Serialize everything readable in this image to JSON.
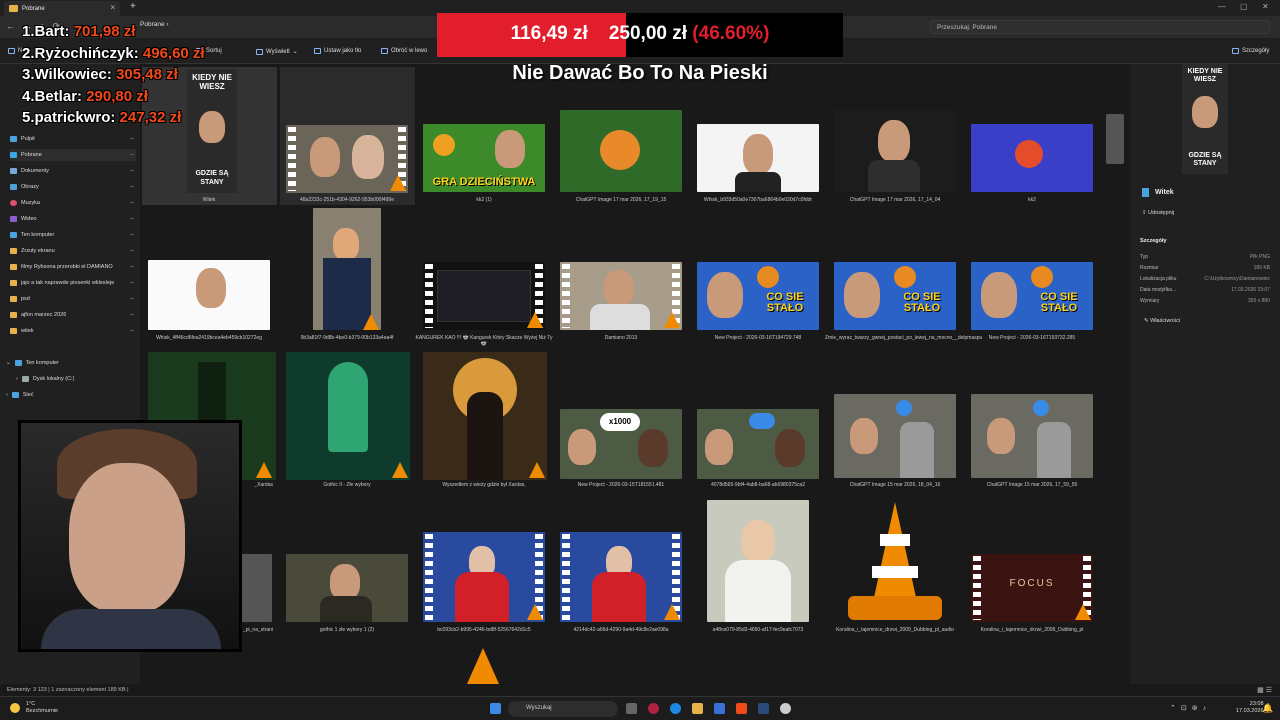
{
  "window": {
    "tab_title": "Pobrane",
    "breadcrumb": "Pobrane",
    "search_placeholder": "Przeszukaj: Pobrane"
  },
  "commands": {
    "view": "Wyświetl",
    "sort": "Sortuj",
    "set_background": "Ustaw jako tło",
    "rotate_left": "Obróć w lewo",
    "details": "Szczegóły",
    "new": "No"
  },
  "sidebar": {
    "items": [
      {
        "label": "Pulpit"
      },
      {
        "label": "Pobrane"
      },
      {
        "label": "Dokumenty"
      },
      {
        "label": "Obrazy"
      },
      {
        "label": "Muzyka"
      },
      {
        "label": "Wideo"
      },
      {
        "label": "Ten komputer"
      },
      {
        "label": "Zrzuty ekranu"
      },
      {
        "label": "filmy Rybsona przerobki el DAMIANO"
      },
      {
        "label": "jajo a tak naprawde piosenki wklesleje"
      },
      {
        "label": "psd"
      },
      {
        "label": "ajfon marzec 2026"
      },
      {
        "label": "witek"
      }
    ],
    "tree": [
      {
        "label": "Ten komputer"
      },
      {
        "label": "Dysk lokalny (C:)"
      },
      {
        "label": "Sieć"
      }
    ]
  },
  "files": [
    {
      "caption": "Witek"
    },
    {
      "caption": "48a2233c-251b-4304-9262-953b000f499e"
    },
    {
      "caption": "kk2 (1)"
    },
    {
      "caption": "ChatGPT Image 17 mar 2026, 17_19_15"
    },
    {
      "caption": "Whisk_b933d50a0e7307ba6864b0e030d7c0fddr"
    },
    {
      "caption": "ChatGPT Image 17 mar 2026, 17_14_04"
    },
    {
      "caption": "kk2"
    },
    {
      "caption": "Whisk_4ff46cd6fea2419bcea4eb459cb10272eg"
    },
    {
      "caption": "9b3a81f7-9d8b-4be0-b379-00b133a4ea4f"
    },
    {
      "caption": "KANGUREK KAO !!! 🐨 Kangurek Który Skacze Wyżej Niż Ty 🐨"
    },
    {
      "caption": "Damiano 2013"
    },
    {
      "caption": "New Project - 2026-03-16T194729.748"
    },
    {
      "caption": "Zmie_wyraz_twarzy_gwnej_postaci_po_lewej_na_mocno__delpmaspu"
    },
    {
      "caption": "New Project - 2026-03-16T193732.285"
    },
    {
      "caption": "_Xardas"
    },
    {
      "caption": "Gothic II - Złe wybory"
    },
    {
      "caption": "Wyszedłem z wieży gdzie był Xardas,"
    },
    {
      "caption": "New Project - 2026-03-15T181551.481"
    },
    {
      "caption": "4078d565-9bf4-4ab8-ba68-ab6980375ca2"
    },
    {
      "caption": "ChatGPT Image 15 mar 2026, 18_04_16"
    },
    {
      "caption": "ChatGPT Image 15 mar 2026, 17_59_55"
    },
    {
      "caption": "_pi_na_strani"
    },
    {
      "caption": "gothic 1 złe wybory 1 (2)"
    },
    {
      "caption": "bc093cb2-b995-4246-bd8f-52567642d1c5"
    },
    {
      "caption": "4214dc42-a66d-4290-9a4d-49c8e2ae098a"
    },
    {
      "caption": "a48ce079-85d3-4650-af17-fec9eafc7073"
    },
    {
      "caption": "Koralina_i_tajemnice_drzwi_2009_Dubbing_pl_audio"
    },
    {
      "caption": "Koralina_i_tajemnice_drzwi_2009_Dubbing_pl"
    }
  ],
  "thumb_text": {
    "gra": "GRA DZIECIŃSTWA",
    "co_sie": "CO SIE STAŁO",
    "kiedy": "KIEDY NIE WIESZ",
    "gdzie": "GDZIE SĄ STANY",
    "x1000": "x1000",
    "focus": "FOCUS"
  },
  "details": {
    "title": "Witek",
    "share": "Udostępnij",
    "section": "Szczegóły",
    "rows": [
      {
        "k": "Typ",
        "v": "Plik PNG"
      },
      {
        "k": "Rozmiar",
        "v": "189 KB"
      },
      {
        "k": "Lokalizacja pliku",
        "v": "C:\\Użytkownicy\\Damianowiec"
      },
      {
        "k": "Data modyfika...",
        "v": "17.03.2026 23:07"
      },
      {
        "k": "Wymiary",
        "v": "355 x 880"
      }
    ],
    "properties": "Właściwości"
  },
  "status": {
    "count": "Elementy: 3 123",
    "selected": "1 zaznaczony element 189 KB"
  },
  "taskbar": {
    "search": "Wyszukaj",
    "weather_temp": "1°C",
    "weather_desc": "Bezchmurnie",
    "time": "23:08",
    "date": "17.03.2026"
  },
  "overlay": {
    "leaderboard": [
      {
        "rank": "1.Bart:",
        "amount": "701,98 zł"
      },
      {
        "rank": "2.Ryżochińczyk:",
        "amount": "496,60 zł"
      },
      {
        "rank": "3.Wilkowiec:",
        "amount": "305,48 zł"
      },
      {
        "rank": "4.Betlar:",
        "amount": "290,80 zł"
      },
      {
        "rank": "5.patrickwro:",
        "amount": "247,32 zł"
      }
    ],
    "goal_current": "116,49 zł",
    "goal_target": "250,00 zł",
    "goal_percent": "(46.60%)",
    "goal_fraction": 0.466,
    "goal_title": "Nie Dawać Bo To Na Pieski"
  },
  "colors": {
    "accent": "#e21d2c",
    "leader_amount": "#f04a1a",
    "folder": "#e6b34a"
  }
}
